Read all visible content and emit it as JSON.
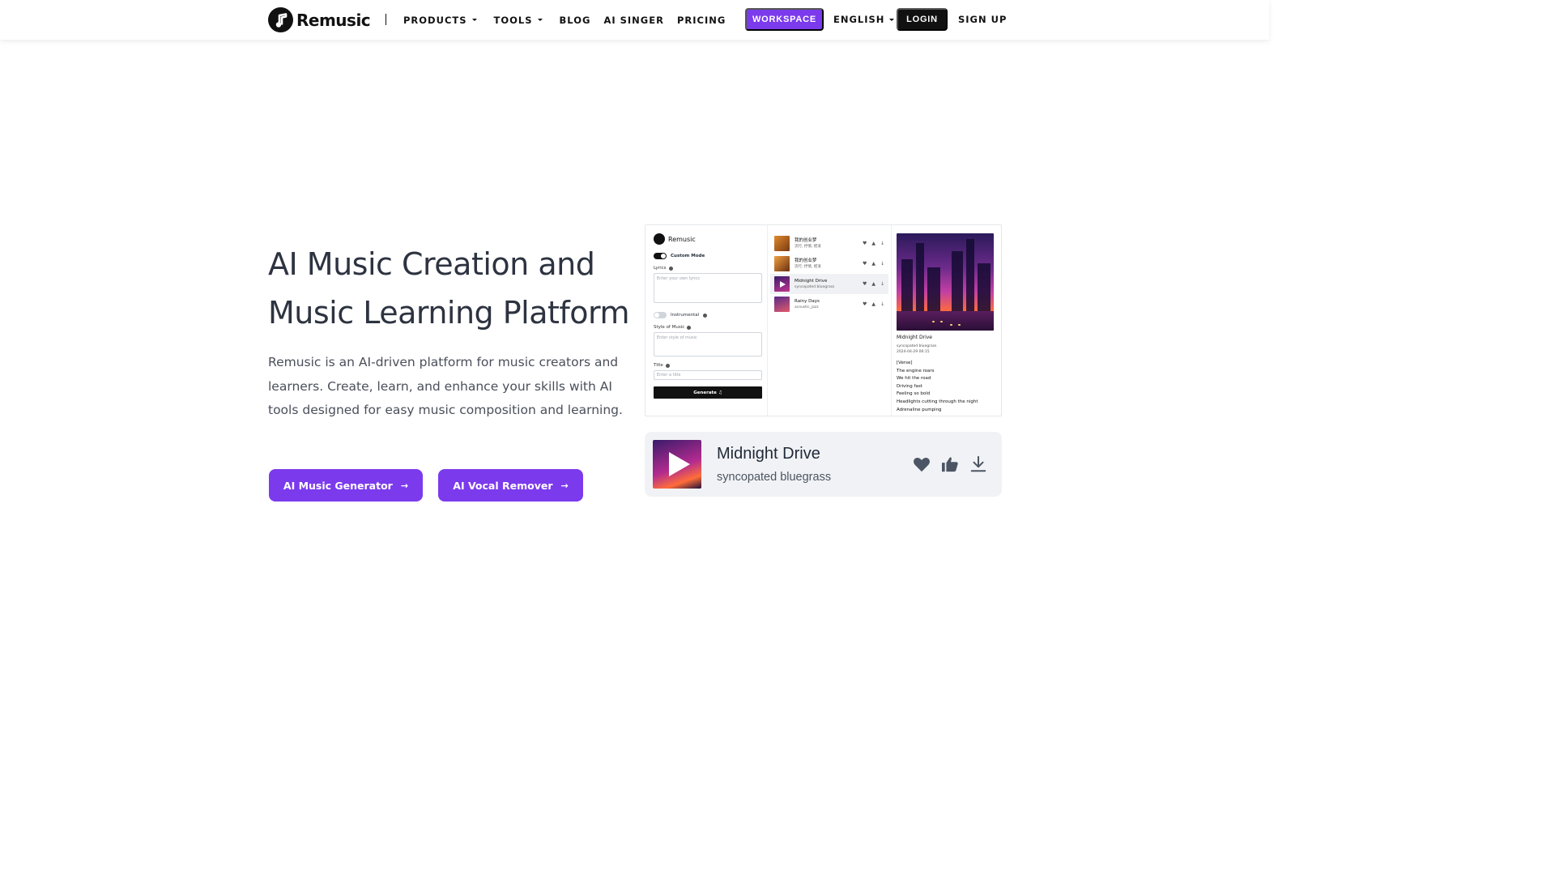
{
  "brand": {
    "name": "Remusic"
  },
  "nav": {
    "links": [
      {
        "label": "PRODUCTS",
        "dropdown": true
      },
      {
        "label": "TOOLS",
        "dropdown": true
      },
      {
        "label": "BLOG",
        "dropdown": false
      },
      {
        "label": "AI SINGER",
        "dropdown": false
      },
      {
        "label": "PRICING",
        "dropdown": false
      }
    ],
    "workspace": "WORKSPACE",
    "language": "ENGLISH",
    "login": "LOGIN",
    "signup": "SIGN UP"
  },
  "hero": {
    "title_line1": "AI Music Creation and",
    "title_line2": "Music Learning Platform",
    "description": "Remusic is an AI-driven platform for music creators and learners. Create, learn, and enhance your skills with AI tools designed for easy music composition and learning.",
    "cta_primary": "AI Music Generator",
    "cta_secondary": "AI Vocal Remover"
  },
  "preview": {
    "app_name": "Remusic",
    "custom_mode": "Custom Mode",
    "lyrics_label": "Lyrics",
    "lyrics_placeholder": "Enter your own lyrics",
    "instrumental_label": "Instrumental",
    "style_label": "Style of Music",
    "style_placeholder": "Enter style of music",
    "title_label": "Title",
    "title_placeholder": "Enter a title",
    "generate_button": "Generate ♫",
    "songs": [
      {
        "title": "我的创业梦",
        "sub": "流行, 抒情, 摇滚",
        "active": false
      },
      {
        "title": "我的创业梦",
        "sub": "流行, 抒情, 摇滚",
        "active": false
      },
      {
        "title": "Midnight Drive",
        "sub": "syncopated bluegrass",
        "active": true
      },
      {
        "title": "Rainy Days",
        "sub": "acoustic_jazz",
        "active": false
      }
    ],
    "detail": {
      "title": "Midnight Drive",
      "style": "syncopated bluegrass",
      "date": "2024-04-29 06:15",
      "lyrics": [
        "[Verse]",
        "The engine roars",
        "We hit the road",
        "Driving fast",
        "Feeling so bold",
        "Headlights cutting through the night",
        "Adrenaline pumping"
      ]
    }
  },
  "player": {
    "title": "Midnight Drive",
    "subtitle": "syncopated bluegrass"
  },
  "colors": {
    "accent": "#7c3aed",
    "dark": "#111111",
    "card_bg": "#f1f2f5"
  }
}
